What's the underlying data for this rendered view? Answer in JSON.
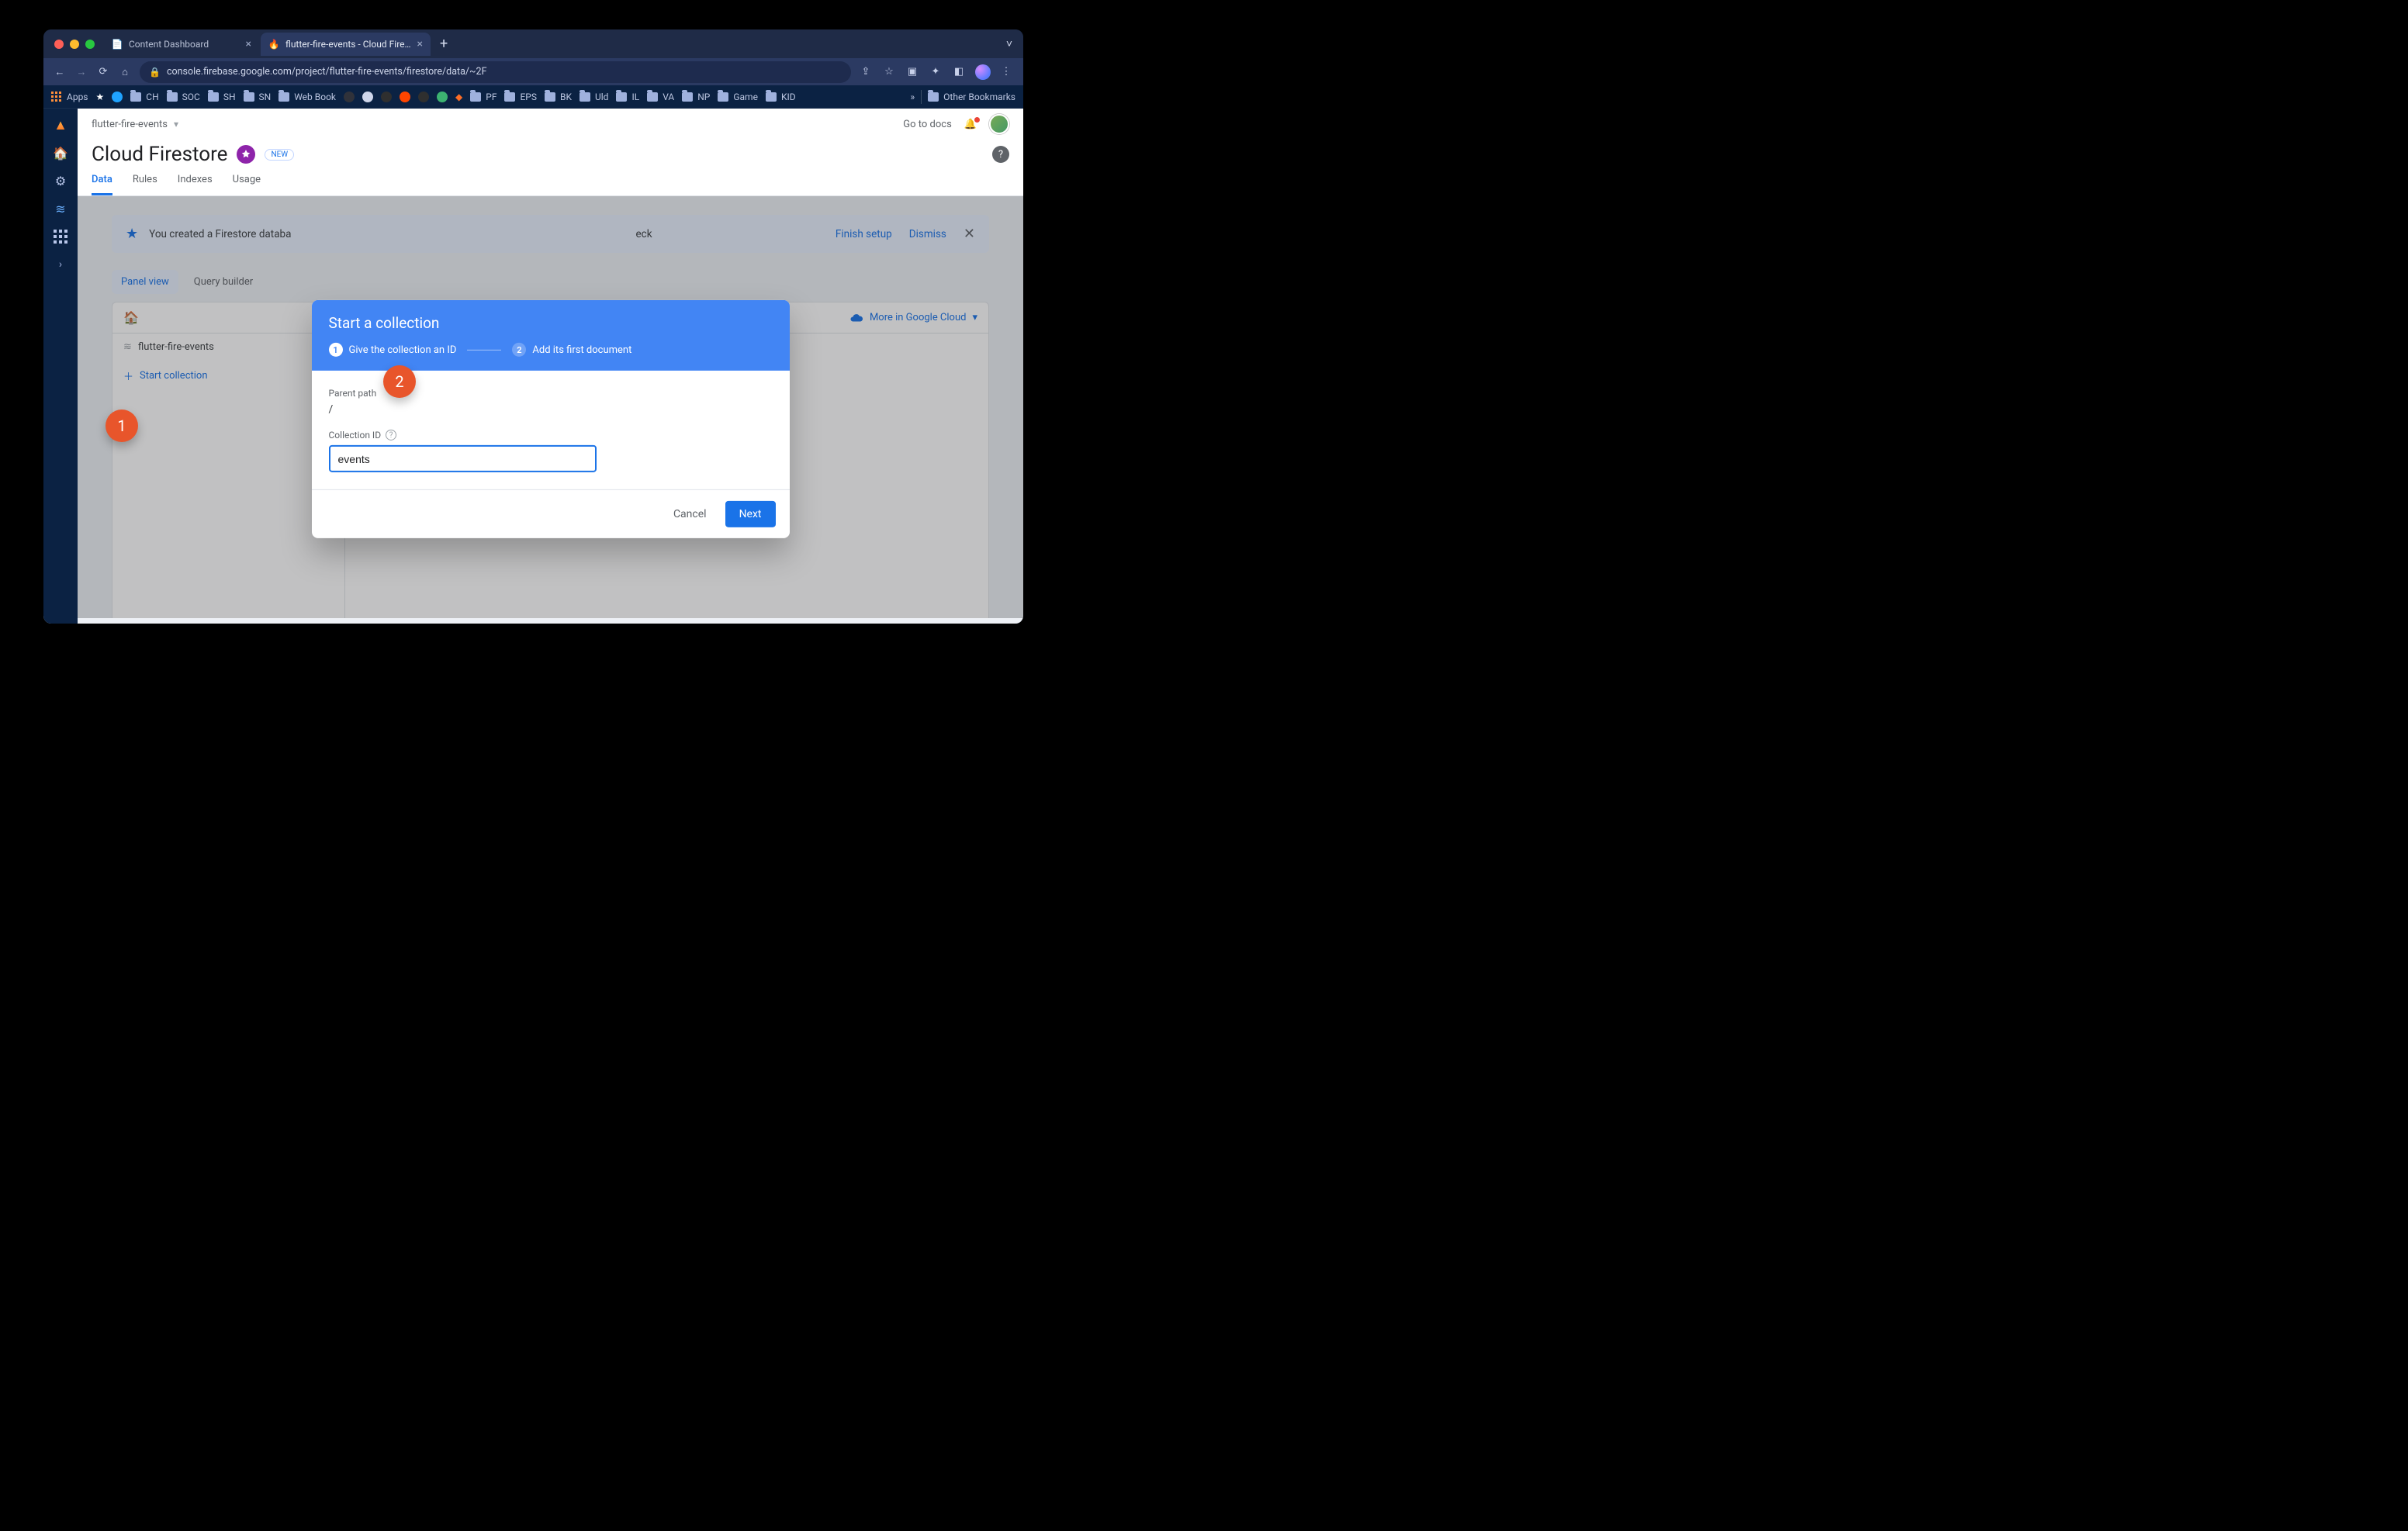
{
  "browser": {
    "tabs": [
      {
        "title": "Content Dashboard",
        "active": false
      },
      {
        "title": "flutter-fire-events - Cloud Fire…",
        "active": true
      }
    ],
    "url": "console.firebase.google.com/project/flutter-fire-events/firestore/data/~2F",
    "bookmarks_label_apps": "Apps",
    "bookmarks": [
      "CH",
      "SOC",
      "SH",
      "SN",
      "Web Book",
      "",
      "",
      "",
      "",
      "",
      "",
      "PF",
      "EPS",
      "BK",
      "Uld",
      "IL",
      "VA",
      "NP",
      "Game",
      "KID"
    ],
    "bookmarks_folders": [
      "CH",
      "SOC",
      "SH",
      "SN",
      "Web Book",
      "PF",
      "EPS",
      "BK",
      "Uld",
      "IL",
      "VA",
      "NP",
      "Game",
      "KID"
    ],
    "other_bookmarks": "Other Bookmarks",
    "overflow": "»"
  },
  "header": {
    "project": "flutter-fire-events",
    "go_to_docs": "Go to docs"
  },
  "title": {
    "text": "Cloud Firestore",
    "new_badge": "NEW"
  },
  "tabs": {
    "items": [
      "Data",
      "Rules",
      "Indexes",
      "Usage"
    ],
    "active": "Data"
  },
  "banner": {
    "text_prefix": "You created a Firestore databa",
    "text_check_suffix": "eck",
    "finish": "Finish setup",
    "dismiss": "Dismiss"
  },
  "view_toggle": {
    "panel": "Panel view",
    "query": "Query builder"
  },
  "panel": {
    "breadcrumb_home": "home",
    "more_in_cloud": "More in Google Cloud",
    "db_name": "flutter-fire-events",
    "start_collection": "Start collection"
  },
  "dialog": {
    "title": "Start a collection",
    "step1": "Give the collection an ID",
    "step2": "Add its first document",
    "parent_path_label": "Parent path",
    "parent_path_value": "/",
    "collection_id_label": "Collection ID",
    "collection_id_value": "events",
    "cancel": "Cancel",
    "next": "Next"
  },
  "callouts": {
    "one": "1",
    "two": "2"
  }
}
